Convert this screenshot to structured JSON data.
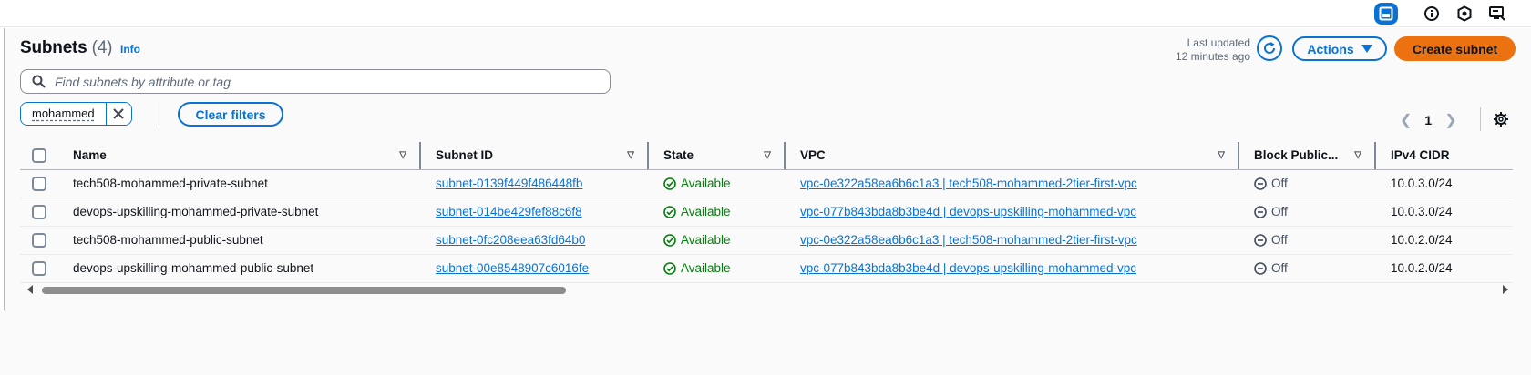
{
  "topbar": {
    "icons": [
      "panel-icon",
      "info-circle-icon",
      "gear-hex-icon",
      "screen-feedback-icon"
    ]
  },
  "header": {
    "title": "Subnets",
    "count": "(4)",
    "info_label": "Info",
    "last_updated_line1": "Last updated",
    "last_updated_line2": "12 minutes ago",
    "actions_label": "Actions",
    "create_label": "Create subnet"
  },
  "search": {
    "placeholder": "Find subnets by attribute or tag"
  },
  "filter": {
    "token": "mohammed",
    "clear_label": "Clear filters"
  },
  "pagination": {
    "page": "1"
  },
  "table": {
    "columns": [
      "Name",
      "Subnet ID",
      "State",
      "VPC",
      "Block Public...",
      "IPv4 CIDR"
    ],
    "rows": [
      {
        "name": "tech508-mohammed-private-subnet",
        "subnet_id": "subnet-0139f449f486448fb",
        "state": "Available",
        "vpc": "vpc-0e322a58ea6b6c1a3 | tech508-mohammed-2tier-first-vpc",
        "block": "Off",
        "cidr": "10.0.3.0/24"
      },
      {
        "name": "devops-upskilling-mohammed-private-subnet",
        "subnet_id": "subnet-014be429fef88c6f8",
        "state": "Available",
        "vpc": "vpc-077b843bda8b3be4d | devops-upskilling-mohammed-vpc",
        "block": "Off",
        "cidr": "10.0.3.0/24"
      },
      {
        "name": "tech508-mohammed-public-subnet",
        "subnet_id": "subnet-0fc208eea63fd64b0",
        "state": "Available",
        "vpc": "vpc-0e322a58ea6b6c1a3 | tech508-mohammed-2tier-first-vpc",
        "block": "Off",
        "cidr": "10.0.2.0/24"
      },
      {
        "name": "devops-upskilling-mohammed-public-subnet",
        "subnet_id": "subnet-00e8548907c6016fe",
        "state": "Available",
        "vpc": "vpc-077b843bda8b3be4d | devops-upskilling-mohammed-vpc",
        "block": "Off",
        "cidr": "10.0.2.0/24"
      }
    ]
  },
  "colors": {
    "link": "#0972d3",
    "primary_button": "#ec7211",
    "available": "#037f0c"
  }
}
